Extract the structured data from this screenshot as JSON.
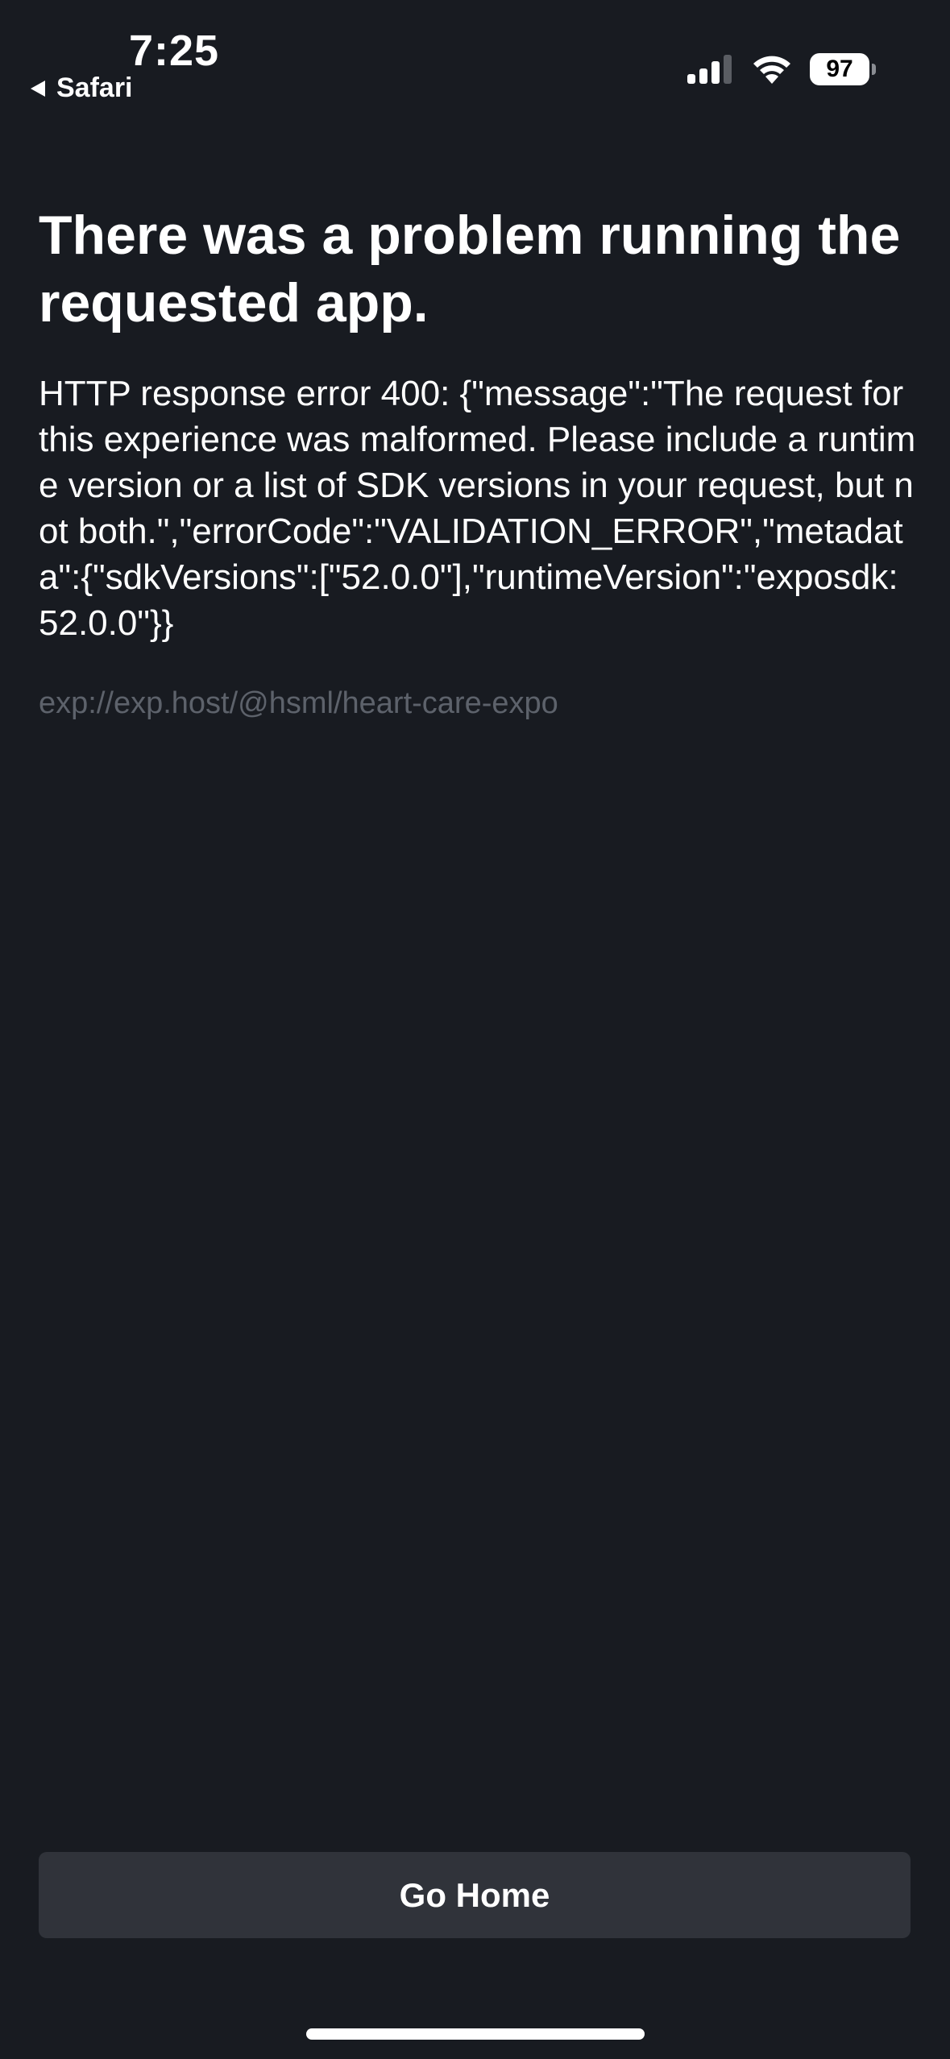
{
  "status_bar": {
    "time": "7:25",
    "back_label": "Safari",
    "battery_level": "97",
    "signal_bars": 3,
    "signal_total": 4
  },
  "error": {
    "title": "There was a problem running the requested app.",
    "message": "HTTP response error 400: {\"message\":\"The request for this experience was malformed. Please include a runtime version or a list of SDK versions in your request, but not both.\",\"errorCode\":\"VALIDATION_ERROR\",\"metadata\":{\"sdkVersions\":[\"52.0.0\"],\"runtimeVersion\":\"exposdk:52.0.0\"}}",
    "url": "exp://exp.host/@hsml/heart-care-expo"
  },
  "actions": {
    "go_home_label": "Go Home"
  },
  "colors": {
    "background": "#181b21",
    "button": "#30333a",
    "muted_text": "#5d626b"
  }
}
